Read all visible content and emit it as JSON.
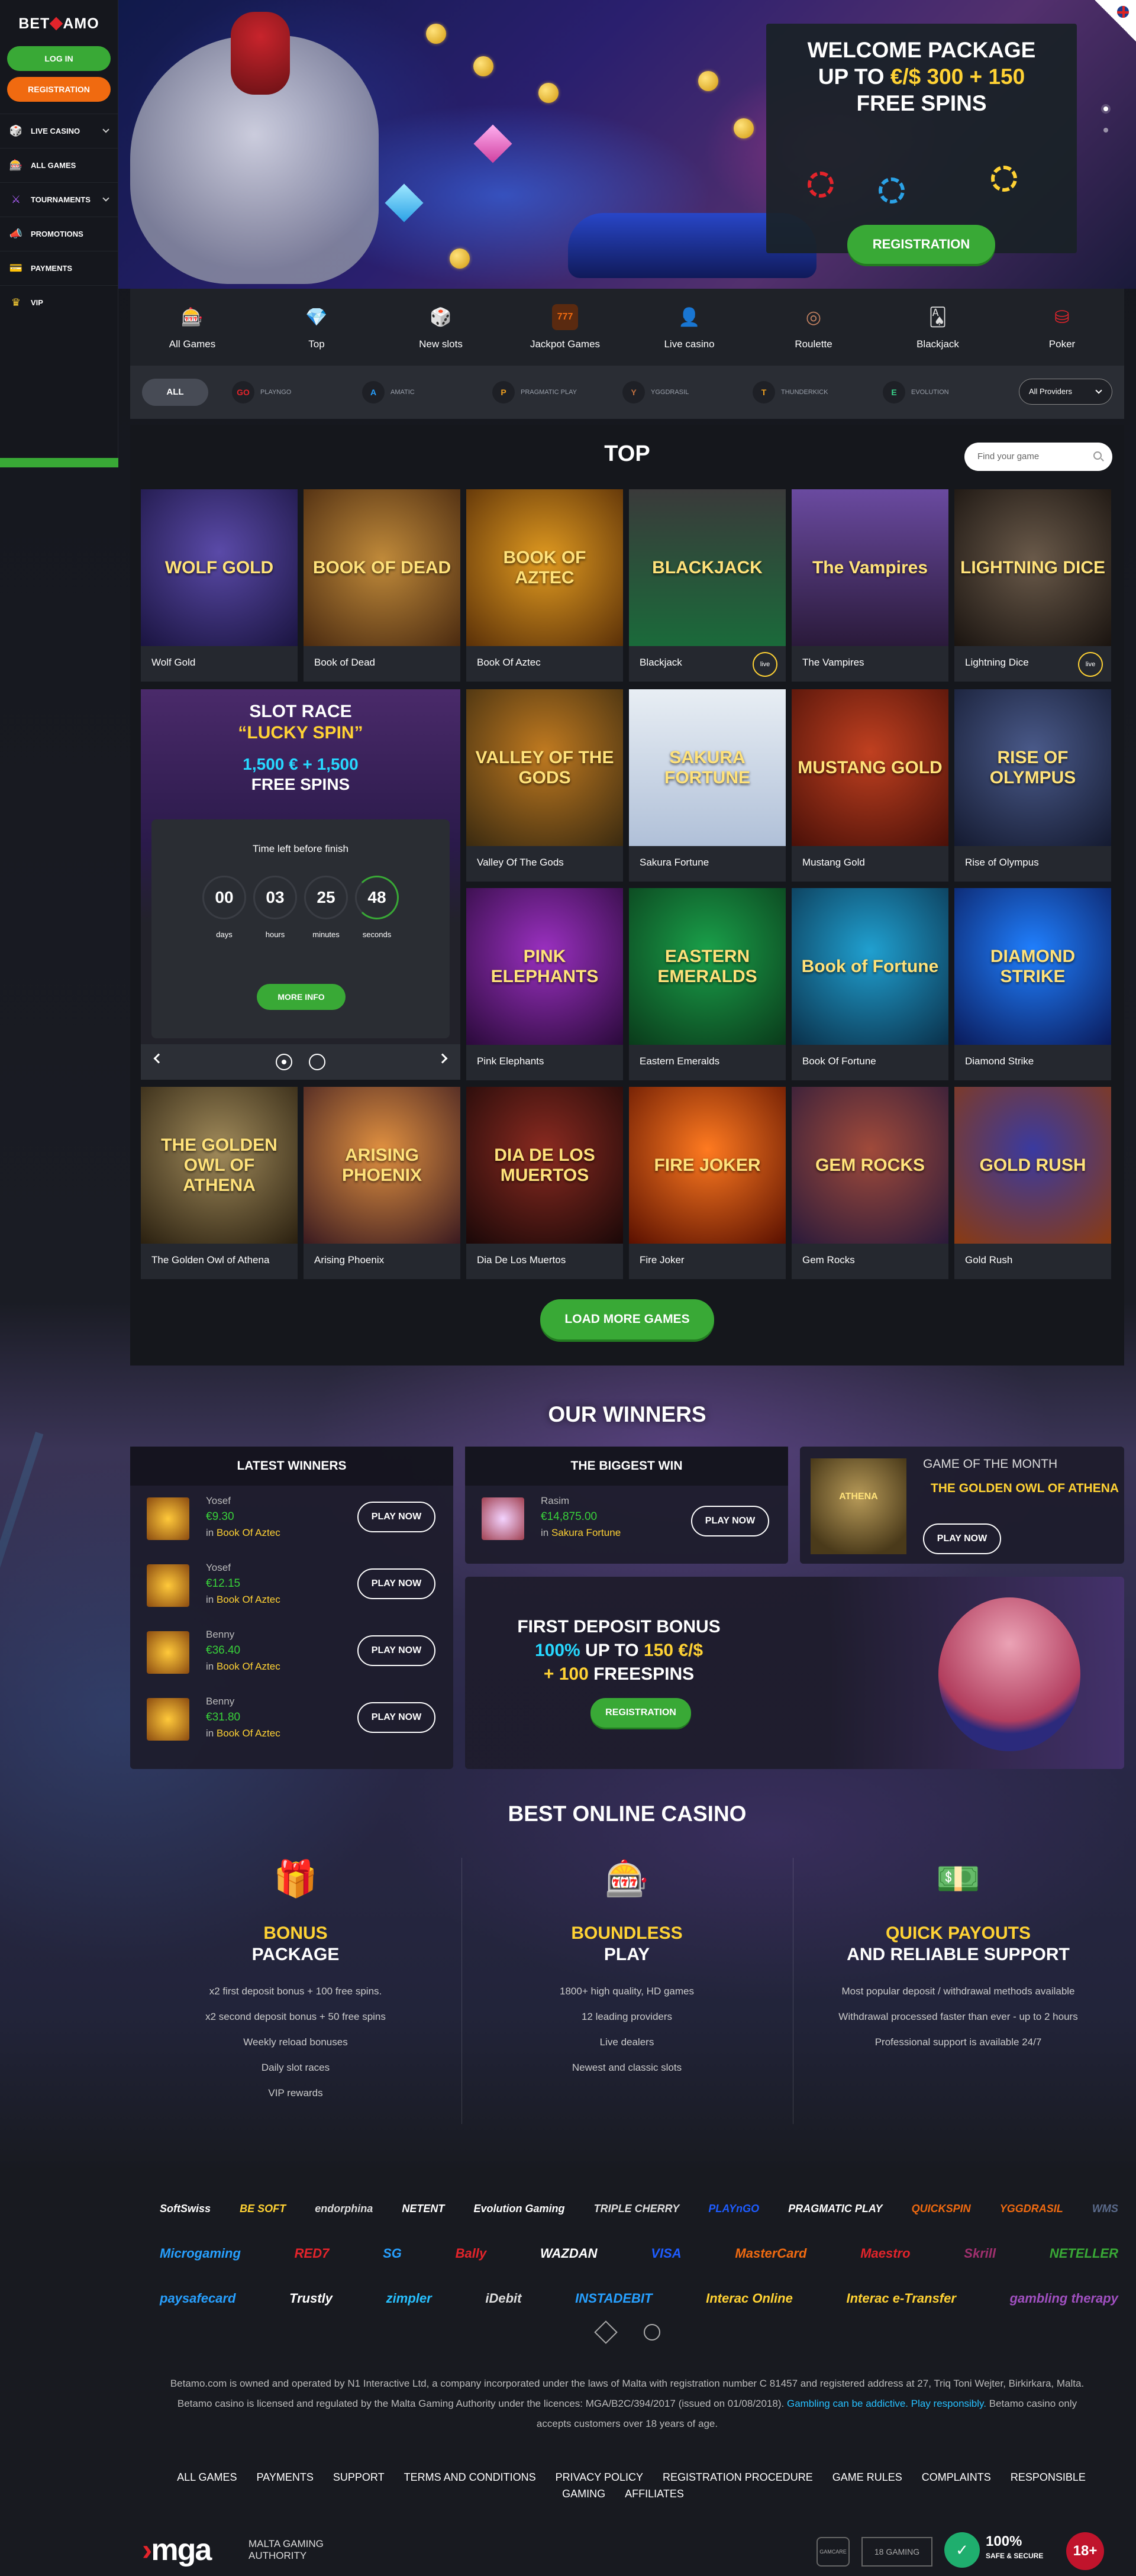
{
  "brand": {
    "name_left": "BET",
    "name_right": "AMO"
  },
  "auth": {
    "login_label": "Log in",
    "register_label": "Registration"
  },
  "sidebar": {
    "items": [
      {
        "label": "Live casino",
        "icon": "dice-icon",
        "has_submenu": true
      },
      {
        "label": "All games",
        "icon": "slot-icon",
        "has_submenu": false
      },
      {
        "label": "Tournaments",
        "icon": "swords-icon",
        "has_submenu": true
      },
      {
        "label": "Promotions",
        "icon": "megaphone-icon",
        "has_submenu": false
      },
      {
        "label": "Payments",
        "icon": "wallet-icon",
        "has_submenu": false
      },
      {
        "label": "VIP",
        "icon": "crown-icon",
        "has_submenu": false
      }
    ]
  },
  "hero": {
    "title_line1": "WELCOME PACKAGE",
    "title_line2_prefix": "UP TO ",
    "title_line2_highlight": "€/$ 300 + 150",
    "title_line3": "FREE SPINS",
    "cta_label": "Registration",
    "slides_count": 2,
    "active_slide": 0,
    "language": "EN"
  },
  "categories": [
    {
      "label": "All Games",
      "icon": "slot-machine-icon"
    },
    {
      "label": "Top",
      "icon": "diamond-icon"
    },
    {
      "label": "New slots",
      "icon": "dice-icon"
    },
    {
      "label": "Jackpot Games",
      "icon": "jackpot-icon"
    },
    {
      "label": "Live casino",
      "icon": "dealer-icon"
    },
    {
      "label": "Roulette",
      "icon": "roulette-icon"
    },
    {
      "label": "Blackjack",
      "icon": "cards-icon"
    },
    {
      "label": "Poker",
      "icon": "chips-icon"
    }
  ],
  "providers": {
    "all_label": "ALL",
    "items": [
      {
        "label": "PLAYNGO",
        "mark": "GO"
      },
      {
        "label": "AMATIC",
        "mark": "A"
      },
      {
        "label": "PRAGMATIC PLAY",
        "mark": "P"
      },
      {
        "label": "YGGDRASIL",
        "mark": "Y"
      },
      {
        "label": "THUNDERKICK",
        "mark": "T"
      },
      {
        "label": "EVOLUTION",
        "mark": "E"
      }
    ],
    "select_value": "All Providers"
  },
  "top": {
    "title": "TOP",
    "search_placeholder": "Find your game",
    "games": [
      {
        "name": "Wolf Gold",
        "art": "WOLF GOLD",
        "live": false
      },
      {
        "name": "Book of Dead",
        "art": "BOOK OF DEAD",
        "live": false
      },
      {
        "name": "Book Of Aztec",
        "art": "BOOK OF AZTEC",
        "live": false
      },
      {
        "name": "Blackjack",
        "art": "BLACKJACK",
        "live": true
      },
      {
        "name": "The Vampires",
        "art": "The Vampires",
        "live": false
      },
      {
        "name": "Lightning Dice",
        "art": "LIGHTNING DICE",
        "live": true
      },
      {
        "name": "Valley Of The Gods",
        "art": "VALLEY OF THE GODS",
        "live": false
      },
      {
        "name": "Sakura Fortune",
        "art": "SAKURA FORTUNE",
        "live": false
      },
      {
        "name": "Mustang Gold",
        "art": "MUSTANG GOLD",
        "live": false
      },
      {
        "name": "Rise of Olympus",
        "art": "RISE OF OLYMPUS",
        "live": false
      },
      {
        "name": "Pink Elephants",
        "art": "PINK ELEPHANTS",
        "live": false
      },
      {
        "name": "Eastern Emeralds",
        "art": "EASTERN EMERALDS",
        "live": false
      },
      {
        "name": "Book Of Fortune",
        "art": "Book of Fortune",
        "live": false
      },
      {
        "name": "Diamond Strike",
        "art": "DIAMOND STRIKE",
        "live": false
      },
      {
        "name": "The Golden Owl of Athena",
        "art": "THE GOLDEN OWL OF ATHENA",
        "live": false
      },
      {
        "name": "Arising Phoenix",
        "art": "ARISING PHOENIX",
        "live": false
      },
      {
        "name": "Dia De Los Muertos",
        "art": "DIA DE LOS MUERTOS",
        "live": false
      },
      {
        "name": "Fire Joker",
        "art": "FIRE JOKER",
        "live": false
      },
      {
        "name": "Gem Rocks",
        "art": "GEM ROCKS",
        "live": false
      },
      {
        "name": "Gold Rush",
        "art": "GOLD RUSH",
        "live": false
      }
    ],
    "live_badge": "live",
    "load_more_label": "Load more games"
  },
  "race": {
    "title_line1": "SLOT RACE",
    "title_line2": "“LUCKY SPIN”",
    "prize_highlight": "1,500 € + 1,500",
    "prize_line2": "FREE SPINS",
    "timer_label": "Time left before finish",
    "timer": [
      {
        "value": "00",
        "unit": "days"
      },
      {
        "value": "03",
        "unit": "hours"
      },
      {
        "value": "25",
        "unit": "minutes"
      },
      {
        "value": "48",
        "unit": "seconds"
      }
    ],
    "more_label": "More info",
    "slides_count": 2,
    "active_slide": 0
  },
  "winners": {
    "title": "OUR WINNERS",
    "latest_title": "Latest winners",
    "latest": [
      {
        "name": "Yosef",
        "amount": "€9.30",
        "in": "in",
        "game": "Book Of Aztec"
      },
      {
        "name": "Yosef",
        "amount": "€12.15",
        "in": "in",
        "game": "Book Of Aztec"
      },
      {
        "name": "Benny",
        "amount": "€36.40",
        "in": "in",
        "game": "Book Of Aztec"
      },
      {
        "name": "Benny",
        "amount": "€31.80",
        "in": "in",
        "game": "Book Of Aztec"
      }
    ],
    "biggest_title": "The biggest win",
    "biggest": {
      "name": "Rasim",
      "amount": "€14,875.00",
      "in": "in",
      "game": "Sakura Fortune"
    },
    "play_label": "Play now",
    "gotm_label": "GAME OF THE MONTH",
    "gotm_game": "THE GOLDEN OWL OF ATHENA",
    "gotm_art": "ATHENA",
    "deposit_line1": "FIRST DEPOSIT BONUS",
    "deposit_pct": "100%",
    "deposit_mid": " UP TO ",
    "deposit_amount": "150 €/$",
    "deposit_plus": "+ 100",
    "deposit_end": " FREESPINS",
    "deposit_cta": "Registration"
  },
  "best": {
    "title": "BEST ONLINE CASINO",
    "features": [
      {
        "icon": "gift-icon",
        "title_hl": "BONUS",
        "title": "PACKAGE",
        "items": [
          "x2 first deposit bonus + 100 free spins.",
          "x2 second deposit bonus + 50 free spins",
          "Weekly reload bonuses",
          "Daily slot races",
          "VIP rewards"
        ]
      },
      {
        "icon": "slot-machine-icon",
        "title_hl": "BOUNDLESS",
        "title": "PLAY",
        "items": [
          "1800+ high quality, HD games",
          "12 leading  providers",
          "Live dealers",
          "Newest and classic slots"
        ]
      },
      {
        "icon": "money-icon",
        "title_hl": "QUICK PAYOUTS",
        "title": "AND RELIABLE SUPPORT",
        "items": [
          "Most popular deposit / withdrawal methods available",
          "Withdrawal processed faster than ever - up to 2 hours",
          "Professional support is available 24/7"
        ]
      }
    ]
  },
  "footer": {
    "logo_rows": [
      [
        {
          "t": "SoftSwiss",
          "c": "#ffffff"
        },
        {
          "t": "BE SOFT",
          "c": "#ffd234"
        },
        {
          "t": "endorphina",
          "c": "#dddddd"
        },
        {
          "t": "NETENT",
          "c": "#ffffff"
        },
        {
          "t": "Evolution Gaming",
          "c": "#ffffff"
        },
        {
          "t": "TRIPLE CHERRY",
          "c": "#dddddd"
        },
        {
          "t": "PLAYnGO",
          "c": "#1e5cff"
        },
        {
          "t": "PRAGMATIC PLAY",
          "c": "#ffffff"
        },
        {
          "t": "QUICKSPIN",
          "c": "#f06a10"
        },
        {
          "t": "YGGDRASIL",
          "c": "#f06a10"
        },
        {
          "t": "WMS",
          "c": "#5a6a8a"
        }
      ],
      [
        {
          "t": "Microgaming",
          "c": "#27a0ff"
        },
        {
          "t": "RED7",
          "c": "#e3242b"
        },
        {
          "t": "SG",
          "c": "#27a0ff"
        },
        {
          "t": "Bally",
          "c": "#e3242b"
        },
        {
          "t": "WAZDAN",
          "c": "#ffffff"
        },
        {
          "t": "VISA",
          "c": "#1e5cff"
        },
        {
          "t": "MasterCard",
          "c": "#f06a10"
        },
        {
          "t": "Maestro",
          "c": "#e3242b"
        },
        {
          "t": "Skrill",
          "c": "#a0306e"
        },
        {
          "t": "NETELLER",
          "c": "#39a936"
        }
      ],
      [
        {
          "t": "paysafecard",
          "c": "#27a0ff"
        },
        {
          "t": "Trustly",
          "c": "#ffffff"
        },
        {
          "t": "zimpler",
          "c": "#27c0ff"
        },
        {
          "t": "iDebit",
          "c": "#dddddd"
        },
        {
          "t": "INSTADEBIT",
          "c": "#27a0ff"
        },
        {
          "t": "Interac Online",
          "c": "#ffd234"
        },
        {
          "t": "Interac e-Transfer",
          "c": "#ffd234"
        },
        {
          "t": "gambling therapy",
          "c": "#a050c0"
        }
      ]
    ],
    "legal_1": "Betamo.com is owned and operated by N1 Interactive Ltd, a company incorporated under the laws of Malta with registration number C 81457 and registered address at 27, Triq Toni Wejter, Birkirkara, Malta.",
    "legal_2a": "Betamo casino is licensed and regulated by the Malta Gaming Authority under the licences: MGA/B2C/394/2017 (issued on 01/08/2018).",
    "legal_link": "Gambling can be addictive. Play responsibly.",
    "legal_2b": "Betamo casino only",
    "legal_3": "accepts customers over 18 years of age.",
    "nav": [
      "All games",
      "Payments",
      "Support",
      "Terms and conditions",
      "Privacy policy",
      "Registration procedure",
      "Game rules",
      "Complaints",
      "Responsible gaming",
      "Affiliates"
    ],
    "mga_text": "mga",
    "mga_sub_1": "MALTA GAMING",
    "mga_sub_2": "AUTHORITY",
    "gamcare": "GAMCARE",
    "eighteen_gaming": "18 GAMING",
    "safe_pct": "100%",
    "safe_label": "SAFE & SECURE",
    "age": "18+"
  }
}
